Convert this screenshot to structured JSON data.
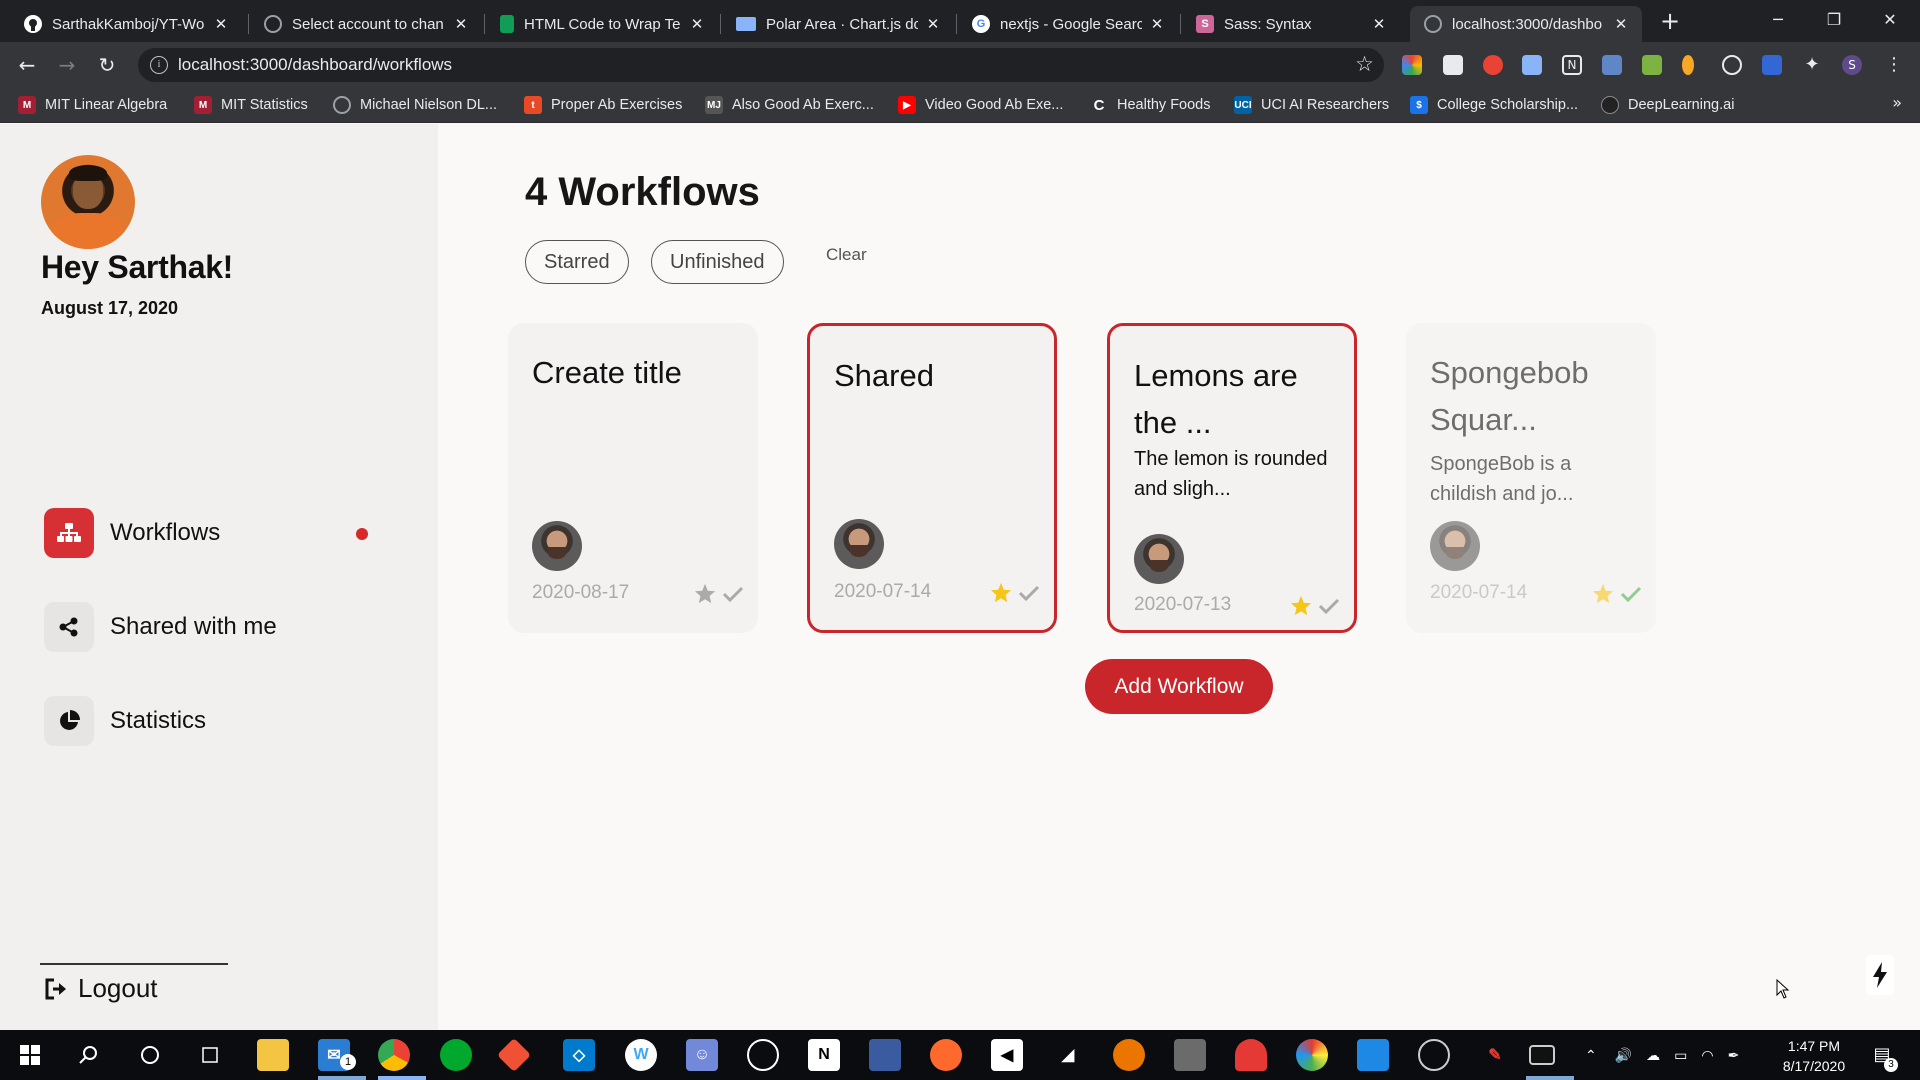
{
  "browser": {
    "tabs": [
      {
        "title": "SarthakKamboj/YT-Wo",
        "favicon": "github-icon",
        "color": "#ffffff"
      },
      {
        "title": "Select account to chan",
        "favicon": "globe-icon",
        "color": "#9aa0a6"
      },
      {
        "title": "HTML Code to Wrap Te",
        "favicon": "document-icon",
        "color": "#0f9d58"
      },
      {
        "title": "Polar Area · Chart.js do",
        "favicon": "book-icon",
        "color": "#8ab4f8"
      },
      {
        "title": "nextjs - Google Search",
        "favicon": "google-icon",
        "color": "#ffffff"
      },
      {
        "title": "Sass: Syntax",
        "favicon": "sass-icon",
        "color": "#cd6799"
      },
      {
        "title": "localhost:3000/dashbo",
        "favicon": "globe-icon",
        "color": "#9aa0a6"
      }
    ],
    "url": "localhost:3000/dashboard/workflows",
    "bookmarks": [
      {
        "label": "MIT Linear Algebra",
        "icon": "mit-icon",
        "color": "#a31f34"
      },
      {
        "label": "MIT Statistics",
        "icon": "mit-icon",
        "color": "#a31f34"
      },
      {
        "label": "Michael Nielson DL...",
        "icon": "globe-icon",
        "color": "#9aa0a6"
      },
      {
        "label": "Proper Ab Exercises",
        "icon": "t-icon",
        "color": "#e84a27"
      },
      {
        "label": "Also Good Ab Exerc...",
        "icon": "mj-icon",
        "color": "#555555"
      },
      {
        "label": "Video Good Ab Exe...",
        "icon": "youtube-icon",
        "color": "#ff0000"
      },
      {
        "label": "Healthy Foods",
        "icon": "c-icon",
        "color": "#ffffff"
      },
      {
        "label": "UCI AI Researchers",
        "icon": "uci-icon",
        "color": "#0064a4"
      },
      {
        "label": "College Scholarship...",
        "icon": "dollar-icon",
        "color": "#1a73e8"
      },
      {
        "label": "DeepLearning.ai",
        "icon": "deeplearning-icon",
        "color": "#222222"
      }
    ]
  },
  "sidebar": {
    "greeting": "Hey Sarthak!",
    "date": "August 17, 2020",
    "nav": [
      {
        "label": "Workflows",
        "icon": "workflow-icon",
        "active": true
      },
      {
        "label": "Shared with me",
        "icon": "share-icon",
        "active": false
      },
      {
        "label": "Statistics",
        "icon": "pie-chart-icon",
        "active": false
      }
    ],
    "logout": "Logout"
  },
  "main": {
    "title": "4 Workflows",
    "filters": [
      "Starred",
      "Unfinished"
    ],
    "clear": "Clear",
    "cards": [
      {
        "title": "Create title",
        "description": "",
        "date": "2020-08-17",
        "starred": false,
        "completed": false,
        "selected": false
      },
      {
        "title": "Shared",
        "description": "",
        "date": "2020-07-14",
        "starred": true,
        "completed": false,
        "selected": true
      },
      {
        "title": "Lemons are the ...",
        "description": "The lemon is rounded and sligh...",
        "date": "2020-07-13",
        "starred": true,
        "completed": false,
        "selected": true
      },
      {
        "title": "Spongebob Squar...",
        "description": "SpongeBob is a childish and jo...",
        "date": "2020-07-14",
        "starred": true,
        "completed": true,
        "selected": false
      }
    ],
    "add_button": "Add Workflow"
  },
  "taskbar": {
    "time": "1:47 PM",
    "date": "8/17/2020",
    "notification_count": "3",
    "mail_badge": "1"
  },
  "colors": {
    "accent": "#c9262b",
    "star": "#f5c518",
    "check": "#4caf50"
  }
}
